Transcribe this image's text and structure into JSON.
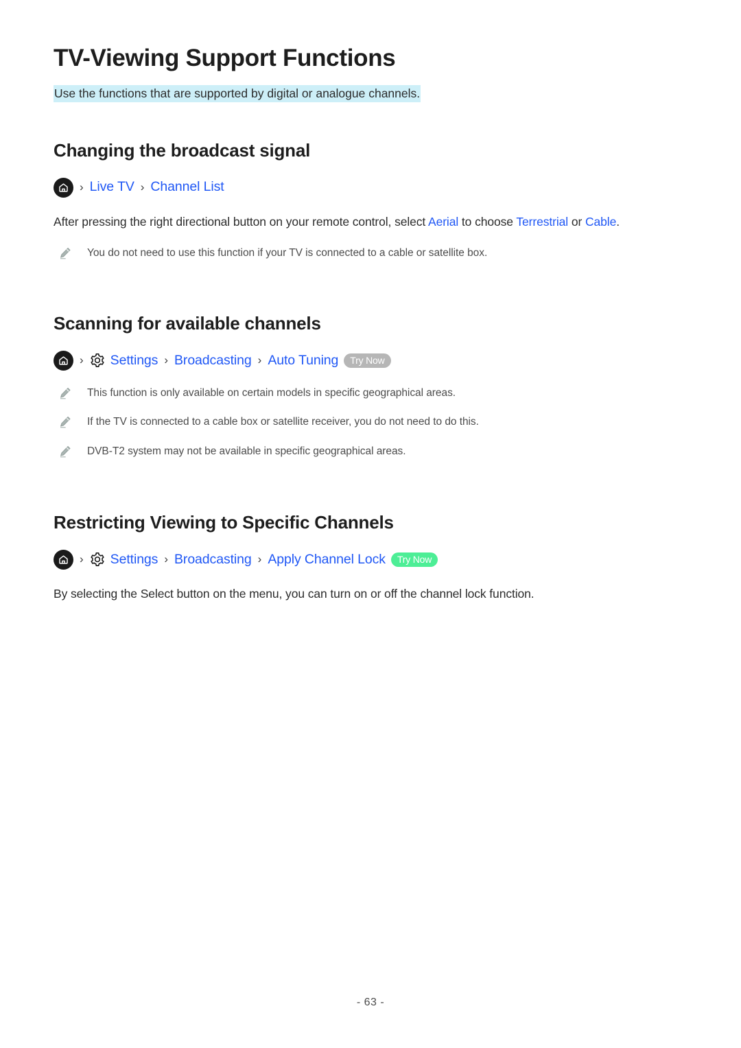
{
  "document": {
    "title": "TV-Viewing Support Functions",
    "subtitle": "Use the functions that are supported by digital or analogue channels.",
    "footer": "- 63 -"
  },
  "colors": {
    "link": "#1f57f5",
    "highlight_background": "#cdeff8",
    "badge_gray": "#b6b6b6",
    "badge_green": "#4dee96",
    "heading_text": "#1d1d1d",
    "body_text": "#2b2b2b",
    "note_text": "#4c4c4c"
  },
  "sections": [
    {
      "heading": "Changing the broadcast signal",
      "breadcrumb": {
        "home_icon": "home-icon",
        "separator": "›",
        "items": [
          {
            "label": "Live TV"
          },
          {
            "label": "Channel List"
          }
        ],
        "badge": null
      },
      "paragraph": {
        "part1": "After pressing the right directional button on your remote control, select ",
        "link1": "Aerial",
        "part2": " to choose ",
        "link2": "Terrestrial",
        "part3": " or ",
        "link3": "Cable",
        "part4": "."
      },
      "notes": [
        "You do not need to use this function if your TV is connected to a cable or satellite box."
      ]
    },
    {
      "heading": "Scanning for available channels",
      "breadcrumb": {
        "home_icon": "home-icon",
        "gear_icon": "gear-icon",
        "separator": "›",
        "items": [
          {
            "label": "Settings"
          },
          {
            "label": "Broadcasting"
          },
          {
            "label": "Auto Tuning"
          }
        ],
        "badge": {
          "label": "Try Now",
          "style": "gray"
        }
      },
      "notes": [
        "This function is only available on certain models in specific geographical areas.",
        "If the TV is connected to a cable box or satellite receiver, you do not need to do this.",
        "DVB-T2 system may not be available in specific geographical areas."
      ]
    },
    {
      "heading": "Restricting Viewing to Specific Channels",
      "breadcrumb": {
        "home_icon": "home-icon",
        "gear_icon": "gear-icon",
        "separator": "›",
        "items": [
          {
            "label": "Settings"
          },
          {
            "label": "Broadcasting"
          },
          {
            "label": "Apply Channel Lock"
          }
        ],
        "badge": {
          "label": "Try Now",
          "style": "green"
        }
      },
      "paragraph": {
        "full": "By selecting the Select button on the menu, you can turn on or off the channel lock function."
      }
    }
  ]
}
